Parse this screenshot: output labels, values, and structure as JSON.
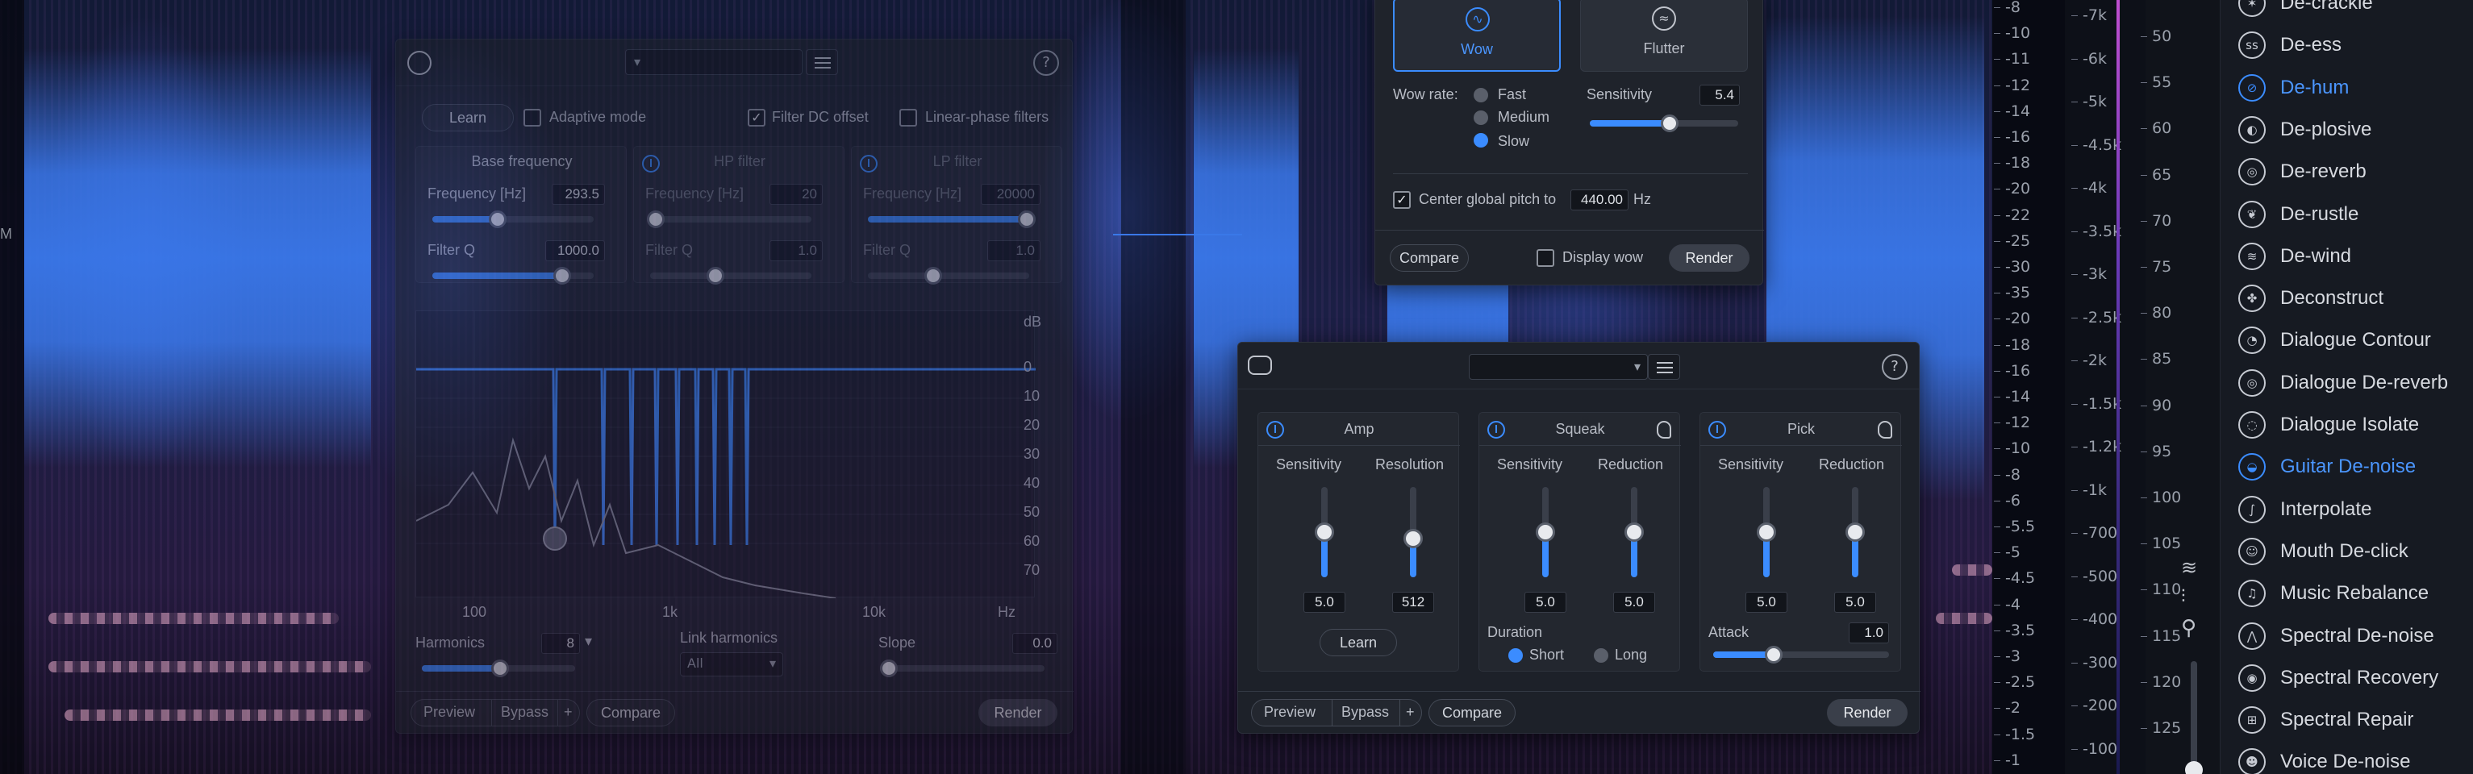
{
  "spectrogram": {
    "left_scale": [
      "M"
    ],
    "hz_scale": [
      "-8",
      "-10",
      "-11",
      "-12",
      "-14",
      "-16",
      "-18",
      "-20",
      "-22",
      "-25",
      "-30",
      "-35",
      "-20",
      "-18",
      "-16",
      "-14",
      "-12",
      "-10",
      "-8",
      "-6",
      "-5.5",
      "-5",
      "-4.5",
      "-4",
      "-3.5",
      "-3",
      "-2.5",
      "-2",
      "-1.5",
      "-1"
    ],
    "freq_scale": [
      "-7k",
      "-6k",
      "-5k",
      "-4.5k",
      "-4k",
      "-3.5k",
      "-3k",
      "-2.5k",
      "-2k",
      "-1.5k",
      "-1.2k",
      "-1k",
      "-700",
      "-500",
      "-400",
      "-300",
      "-200",
      "-100"
    ],
    "db_scale": [
      "50",
      "55",
      "60",
      "65",
      "70",
      "75",
      "80",
      "85",
      "90",
      "95",
      "100",
      "105",
      "110",
      "115",
      "120",
      "125"
    ]
  },
  "modules": {
    "active": "De-hum",
    "items": [
      {
        "label": "De-crackle",
        "icon": "crackle-icon"
      },
      {
        "label": "De-ess",
        "icon": "ess-icon"
      },
      {
        "label": "De-hum",
        "icon": "hum-icon"
      },
      {
        "label": "De-plosive",
        "icon": "plosive-icon"
      },
      {
        "label": "De-reverb",
        "icon": "reverb-icon"
      },
      {
        "label": "De-rustle",
        "icon": "rustle-icon"
      },
      {
        "label": "De-wind",
        "icon": "wind-icon"
      },
      {
        "label": "Deconstruct",
        "icon": "deconstruct-icon"
      },
      {
        "label": "Dialogue Contour",
        "icon": "contour-icon"
      },
      {
        "label": "Dialogue De-reverb",
        "icon": "dialogue-reverb-icon"
      },
      {
        "label": "Dialogue Isolate",
        "icon": "isolate-icon"
      },
      {
        "label": "Guitar De-noise",
        "icon": "guitar-icon"
      },
      {
        "label": "Interpolate",
        "icon": "interpolate-icon"
      },
      {
        "label": "Mouth De-click",
        "icon": "mouth-icon"
      },
      {
        "label": "Music Rebalance",
        "icon": "rebalance-icon"
      },
      {
        "label": "Spectral De-noise",
        "icon": "spectral-denoise-icon"
      },
      {
        "label": "Spectral Recovery",
        "icon": "recovery-icon"
      },
      {
        "label": "Spectral Repair",
        "icon": "repair-icon"
      },
      {
        "label": "Voice De-noise",
        "icon": "voice-icon"
      }
    ]
  },
  "dehum": {
    "learn": "Learn",
    "adaptive_mode": "Adaptive mode",
    "filter_dc": "Filter DC offset",
    "linear_phase": "Linear-phase filters",
    "base_frequency": {
      "title": "Base frequency",
      "freq_label": "Frequency [Hz]",
      "freq_value": "293.5",
      "q_label": "Filter Q",
      "q_value": "1000.0"
    },
    "hp_filter": {
      "title": "HP filter",
      "freq_label": "Frequency [Hz]",
      "freq_value": "20",
      "q_label": "Filter Q",
      "q_value": "1.0"
    },
    "lp_filter": {
      "title": "LP filter",
      "freq_label": "Frequency [Hz]",
      "freq_value": "20000",
      "q_label": "Filter Q",
      "q_value": "1.0"
    },
    "graph": {
      "db_label": "dB",
      "db_ticks": [
        "0",
        "10",
        "20",
        "30",
        "40",
        "50",
        "60",
        "70"
      ],
      "hz_ticks": [
        "100",
        "1k",
        "10k",
        "Hz"
      ]
    },
    "harmonics_label": "Harmonics",
    "harmonics_value": "8",
    "link_harmonics_label": "Link harmonics",
    "link_harmonics_value": "All",
    "slope_label": "Slope",
    "slope_value": "0.0",
    "footer": {
      "preview": "Preview",
      "bypass": "Bypass",
      "plus": "+",
      "compare": "Compare",
      "render": "Render"
    }
  },
  "wow": {
    "tab_wow": "Wow",
    "tab_flutter": "Flutter",
    "wow_rate_label": "Wow rate:",
    "rate_options": [
      "Fast",
      "Medium",
      "Slow"
    ],
    "rate_selected": "Slow",
    "sensitivity_label": "Sensitivity",
    "sensitivity_value": "5.4",
    "sensitivity_level": 0.54,
    "center_pitch_label": "Center global pitch to",
    "center_pitch_value": "440.00",
    "center_pitch_unit": "Hz",
    "compare": "Compare",
    "display_wow": "Display wow",
    "render": "Render"
  },
  "guitar": {
    "amp": {
      "title": "Amp",
      "c1": "Sensitivity",
      "c2": "Resolution",
      "v1": "5.0",
      "v2": "512",
      "learn": "Learn"
    },
    "squeak": {
      "title": "Squeak",
      "c1": "Sensitivity",
      "c2": "Reduction",
      "v1": "5.0",
      "v2": "5.0",
      "duration_label": "Duration",
      "short": "Short",
      "long": "Long"
    },
    "pick": {
      "title": "Pick",
      "c1": "Sensitivity",
      "c2": "Reduction",
      "v1": "5.0",
      "v2": "5.0",
      "attack_label": "Attack",
      "attack_value": "1.0"
    },
    "footer": {
      "preview": "Preview",
      "bypass": "Bypass",
      "plus": "+",
      "compare": "Compare",
      "render": "Render"
    }
  }
}
